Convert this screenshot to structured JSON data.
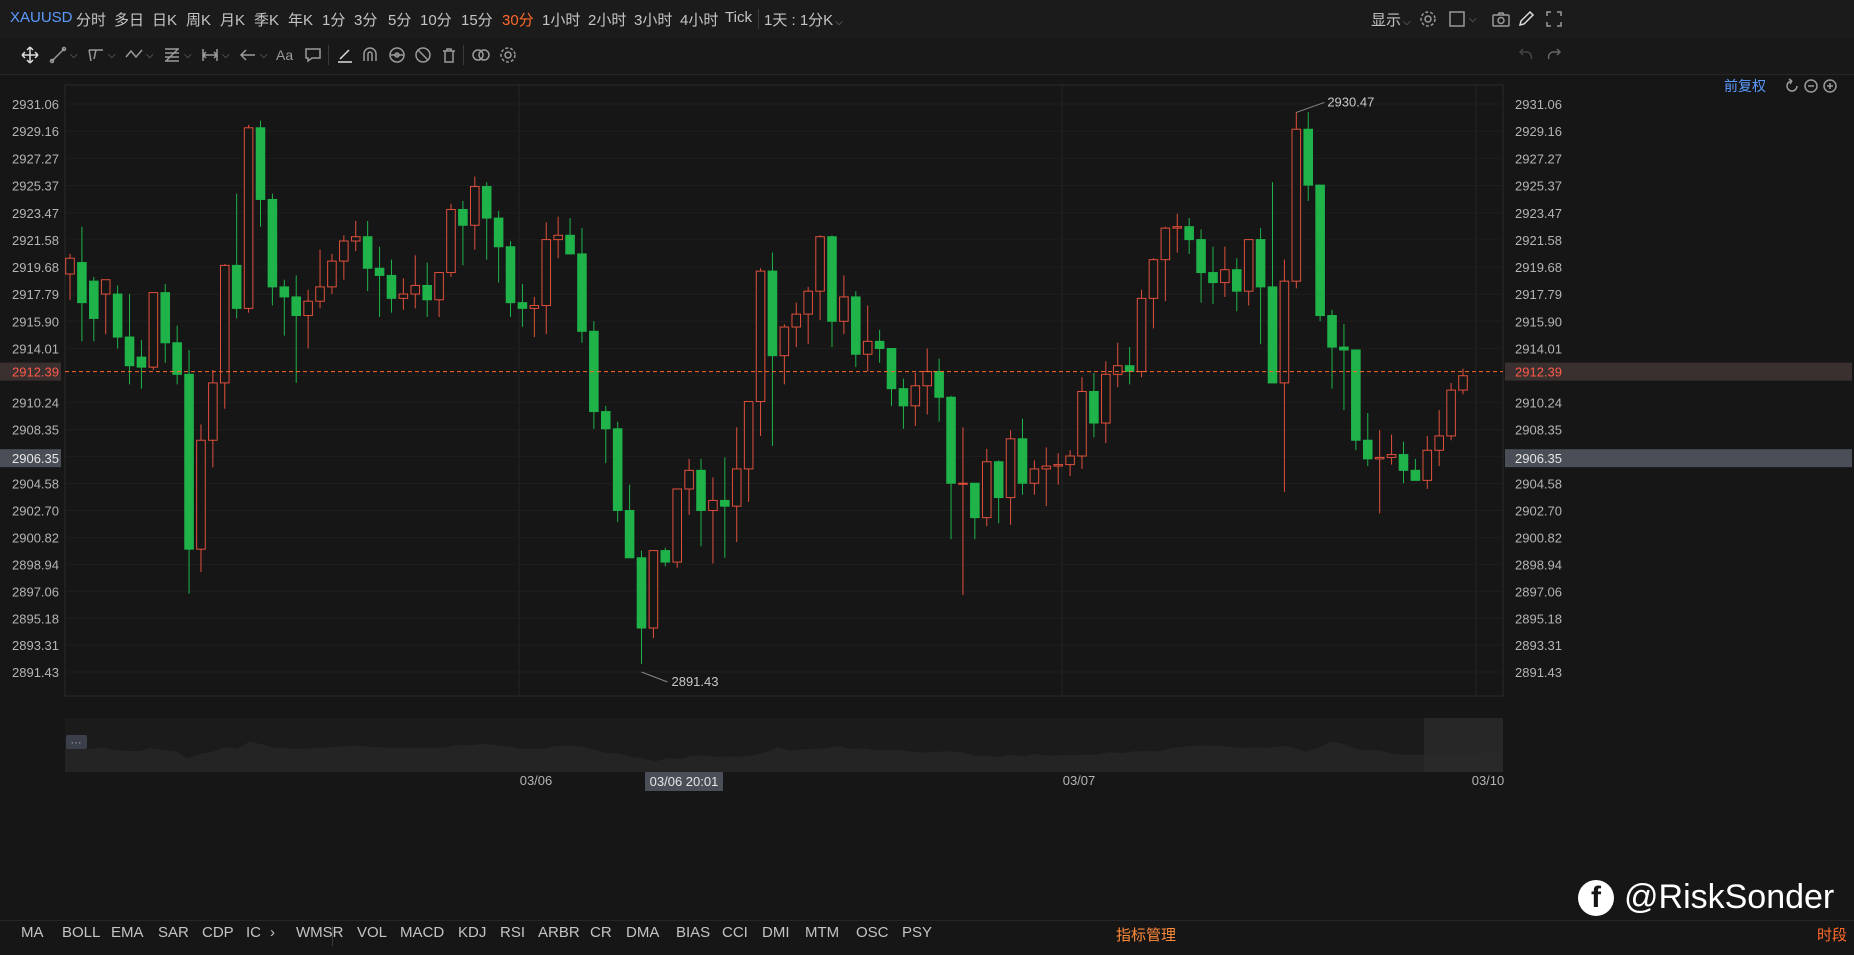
{
  "symbol": "XAUUSD",
  "timeframes": [
    "分时",
    "多日",
    "日K",
    "周K",
    "月K",
    "季K",
    "年K",
    "1分",
    "3分",
    "5分",
    "10分",
    "15分",
    "30分",
    "1小时",
    "2小时",
    "3小时",
    "4小时",
    "Tick"
  ],
  "active_timeframe": "30分",
  "kline_combo": "1天 : 1分K",
  "display_label": "显示",
  "restore_label": "前复权",
  "toolbar_icons": [
    "move-icon",
    "line-icon",
    "channel-icon",
    "zigzag-icon",
    "fib-icon",
    "measure-icon",
    "arrow-left-icon",
    "text-icon",
    "comment-icon",
    "pen-icon",
    "magnet-icon",
    "eye-icon",
    "hide-icon",
    "trash-icon",
    "link-icon",
    "settings-icon"
  ],
  "header_right_icons": [
    "gear-icon",
    "layout-icon",
    "camera-icon",
    "pencil-icon",
    "fullscreen-icon"
  ],
  "history_icons": [
    "undo-icon",
    "redo-icon"
  ],
  "zoom_icons": [
    "reset-icon",
    "zoom-out-icon",
    "zoom-in-icon"
  ],
  "last_price": "2912.39",
  "crosshair_price": "2906.35",
  "crosshair_time": "03/06 20:01",
  "annotations": {
    "high": "2930.47",
    "low": "2891.43"
  },
  "navigator_dots": "···",
  "indicators": [
    "MA",
    "BOLL",
    "EMA",
    "SAR",
    "CDP",
    "IC",
    "WMSR",
    "VOL",
    "MACD",
    "KDJ",
    "RSI",
    "ARBR",
    "CR",
    "DMA",
    "BIAS",
    "CCI",
    "DMI",
    "MTM",
    "OSC",
    "PSY"
  ],
  "indicator_more": "›",
  "indicator_manage": "指标管理",
  "segment_label": "时段",
  "watermark": "@RiskSonder",
  "colors": {
    "up": "#e0503c",
    "down": "#1fb34a",
    "accent": "#ff6a2a",
    "link": "#5b9bff",
    "background": "#161616"
  },
  "chart_data": {
    "type": "candlestick",
    "y_ticks": [
      "2931.06",
      "2929.16",
      "2927.27",
      "2925.37",
      "2923.47",
      "2921.58",
      "2919.68",
      "2917.79",
      "2915.90",
      "2914.01",
      "2912.11",
      "2910.24",
      "2908.35",
      "2906.46",
      "2904.58",
      "2902.70",
      "2900.82",
      "2898.94",
      "2897.06",
      "2895.18",
      "2893.31",
      "2891.43"
    ],
    "ylim": [
      2889.5,
      2933.0
    ],
    "x_ticks": [
      "03/06",
      "03/07",
      "03/10"
    ],
    "ohlc": [
      [
        2919.2,
        2920.6,
        2917.4,
        2920.3
      ],
      [
        2920.0,
        2922.5,
        2914.5,
        2917.2
      ],
      [
        2918.7,
        2919.0,
        2914.5,
        2916.1
      ],
      [
        2917.8,
        2918.0,
        2915.0,
        2918.8
      ],
      [
        2917.8,
        2918.4,
        2914.0,
        2914.8
      ],
      [
        2914.8,
        2917.8,
        2911.5,
        2912.8
      ],
      [
        2913.4,
        2914.6,
        2911.2,
        2912.7
      ],
      [
        2912.7,
        2917.9,
        2912.5,
        2917.9
      ],
      [
        2917.9,
        2918.5,
        2913.0,
        2914.4
      ],
      [
        2914.4,
        2915.6,
        2911.5,
        2912.2
      ],
      [
        2912.2,
        2913.9,
        2896.9,
        2900.0
      ],
      [
        2900.0,
        2908.7,
        2898.4,
        2907.6
      ],
      [
        2907.6,
        2912.5,
        2905.7,
        2911.6
      ],
      [
        2911.6,
        2919.9,
        2909.8,
        2919.8
      ],
      [
        2919.8,
        2924.8,
        2916.1,
        2916.8
      ],
      [
        2916.8,
        2929.6,
        2916.5,
        2929.4
      ],
      [
        2929.4,
        2929.9,
        2922.5,
        2924.4
      ],
      [
        2924.4,
        2924.8,
        2917.0,
        2918.3
      ],
      [
        2918.3,
        2918.8,
        2914.9,
        2917.6
      ],
      [
        2917.6,
        2919.1,
        2911.6,
        2916.3
      ],
      [
        2916.3,
        2918.1,
        2914.0,
        2917.3
      ],
      [
        2917.3,
        2920.9,
        2916.8,
        2918.3
      ],
      [
        2918.3,
        2920.6,
        2917.8,
        2920.1
      ],
      [
        2920.1,
        2921.9,
        2918.8,
        2921.5
      ],
      [
        2921.5,
        2922.9,
        2920.8,
        2921.8
      ],
      [
        2921.8,
        2922.9,
        2918.0,
        2919.6
      ],
      [
        2919.6,
        2921.1,
        2916.2,
        2919.1
      ],
      [
        2919.1,
        2920.2,
        2916.5,
        2917.5
      ],
      [
        2917.5,
        2918.9,
        2916.7,
        2917.8
      ],
      [
        2917.8,
        2920.5,
        2916.8,
        2918.4
      ],
      [
        2918.4,
        2920.0,
        2916.2,
        2917.4
      ],
      [
        2917.4,
        2918.9,
        2916.2,
        2919.3
      ],
      [
        2919.3,
        2924.1,
        2919.0,
        2923.7
      ],
      [
        2923.7,
        2924.3,
        2919.8,
        2922.6
      ],
      [
        2922.6,
        2926.0,
        2920.9,
        2925.3
      ],
      [
        2925.3,
        2925.6,
        2920.2,
        2923.1
      ],
      [
        2923.1,
        2923.6,
        2918.6,
        2921.1
      ],
      [
        2921.1,
        2921.5,
        2916.2,
        2917.2
      ],
      [
        2917.2,
        2918.5,
        2915.5,
        2916.8
      ],
      [
        2916.8,
        2917.6,
        2914.8,
        2917.0
      ],
      [
        2917.0,
        2922.8,
        2915.0,
        2921.6
      ],
      [
        2921.6,
        2923.2,
        2920.3,
        2921.9
      ],
      [
        2921.9,
        2923.1,
        2920.7,
        2920.6
      ],
      [
        2920.6,
        2922.4,
        2914.4,
        2915.2
      ],
      [
        2915.2,
        2915.9,
        2908.4,
        2909.6
      ],
      [
        2909.6,
        2910.0,
        2906.0,
        2908.4
      ],
      [
        2908.4,
        2908.9,
        2901.9,
        2902.7
      ],
      [
        2902.7,
        2904.5,
        2899.8,
        2899.4
      ],
      [
        2899.4,
        2899.9,
        2892.0,
        2894.5
      ],
      [
        2894.5,
        2899.9,
        2893.8,
        2899.9
      ],
      [
        2899.9,
        2900.1,
        2898.8,
        2899.1
      ],
      [
        2899.1,
        2904.1,
        2898.7,
        2904.2
      ],
      [
        2904.2,
        2906.3,
        2902.4,
        2905.5
      ],
      [
        2905.5,
        2906.3,
        2900.2,
        2902.7
      ],
      [
        2902.7,
        2905.0,
        2899.0,
        2903.4
      ],
      [
        2903.4,
        2906.4,
        2899.4,
        2903.0
      ],
      [
        2903.0,
        2908.5,
        2900.5,
        2905.6
      ],
      [
        2905.6,
        2910.2,
        2903.3,
        2910.3
      ],
      [
        2910.3,
        2919.6,
        2907.9,
        2919.4
      ],
      [
        2919.4,
        2920.7,
        2907.2,
        2913.5
      ],
      [
        2913.5,
        2915.7,
        2911.5,
        2915.5
      ],
      [
        2915.5,
        2917.2,
        2914.1,
        2916.4
      ],
      [
        2916.4,
        2918.3,
        2914.3,
        2918.0
      ],
      [
        2918.0,
        2921.9,
        2916.0,
        2921.8
      ],
      [
        2921.8,
        2921.9,
        2914.1,
        2915.9
      ],
      [
        2915.9,
        2919.1,
        2915.0,
        2917.6
      ],
      [
        2917.6,
        2918.0,
        2912.7,
        2913.6
      ],
      [
        2913.6,
        2917.0,
        2912.4,
        2914.5
      ],
      [
        2914.5,
        2915.3,
        2913.0,
        2914.0
      ],
      [
        2914.0,
        2914.0,
        2910.0,
        2911.2
      ],
      [
        2911.2,
        2911.9,
        2908.4,
        2910.0
      ],
      [
        2910.0,
        2912.3,
        2908.6,
        2911.4
      ],
      [
        2911.4,
        2914.0,
        2909.4,
        2912.4
      ],
      [
        2912.4,
        2913.3,
        2908.9,
        2910.6
      ],
      [
        2910.6,
        2910.7,
        2900.7,
        2904.6
      ],
      [
        2904.6,
        2908.5,
        2896.8,
        2904.6
      ],
      [
        2904.6,
        2904.6,
        2900.7,
        2902.2
      ],
      [
        2902.2,
        2907.0,
        2901.6,
        2906.1
      ],
      [
        2906.1,
        2906.2,
        2901.8,
        2903.6
      ],
      [
        2903.6,
        2908.3,
        2901.7,
        2907.7
      ],
      [
        2907.7,
        2909.1,
        2903.8,
        2904.6
      ],
      [
        2904.6,
        2906.2,
        2903.8,
        2905.6
      ],
      [
        2905.6,
        2907.1,
        2903.0,
        2905.8
      ],
      [
        2905.8,
        2906.7,
        2904.5,
        2905.9
      ],
      [
        2905.9,
        2906.9,
        2905.1,
        2906.5
      ],
      [
        2906.5,
        2912.0,
        2905.6,
        2911.0
      ],
      [
        2911.0,
        2912.3,
        2907.8,
        2908.8
      ],
      [
        2908.8,
        2913.1,
        2907.4,
        2912.2
      ],
      [
        2912.2,
        2914.4,
        2911.3,
        2912.8
      ],
      [
        2912.8,
        2914.1,
        2911.5,
        2912.4
      ],
      [
        2912.4,
        2918.1,
        2912.0,
        2917.5
      ],
      [
        2917.5,
        2920.3,
        2915.4,
        2920.2
      ],
      [
        2920.2,
        2922.5,
        2917.3,
        2922.4
      ],
      [
        2922.4,
        2923.4,
        2920.7,
        2922.5
      ],
      [
        2922.5,
        2923.1,
        2920.6,
        2921.6
      ],
      [
        2921.6,
        2922.3,
        2917.2,
        2919.3
      ],
      [
        2919.3,
        2921.1,
        2917.1,
        2918.6
      ],
      [
        2918.6,
        2921.1,
        2917.6,
        2919.5
      ],
      [
        2919.5,
        2920.3,
        2916.6,
        2918.0
      ],
      [
        2918.0,
        2921.5,
        2917.0,
        2921.6
      ],
      [
        2921.6,
        2922.4,
        2914.3,
        2918.3
      ],
      [
        2918.3,
        2925.6,
        2911.6,
        2911.6
      ],
      [
        2911.6,
        2920.2,
        2904.0,
        2918.7
      ],
      [
        2918.7,
        2930.5,
        2918.2,
        2929.3
      ],
      [
        2929.3,
        2930.5,
        2924.3,
        2925.4
      ],
      [
        2925.4,
        2925.4,
        2915.9,
        2916.3
      ],
      [
        2916.3,
        2916.7,
        2911.2,
        2914.1
      ],
      [
        2914.1,
        2915.7,
        2909.7,
        2913.9
      ],
      [
        2913.9,
        2913.9,
        2906.9,
        2907.6
      ],
      [
        2907.6,
        2909.5,
        2905.8,
        2906.3
      ],
      [
        2906.3,
        2908.3,
        2902.5,
        2906.4
      ],
      [
        2906.4,
        2908.0,
        2905.9,
        2906.6
      ],
      [
        2906.6,
        2907.5,
        2904.6,
        2905.5
      ],
      [
        2905.5,
        2906.3,
        2904.8,
        2904.8
      ],
      [
        2904.8,
        2907.9,
        2904.2,
        2906.9
      ],
      [
        2906.9,
        2909.7,
        2905.8,
        2907.9
      ],
      [
        2907.9,
        2911.6,
        2907.6,
        2911.1
      ],
      [
        2911.1,
        2912.6,
        2910.8,
        2912.1
      ]
    ]
  }
}
